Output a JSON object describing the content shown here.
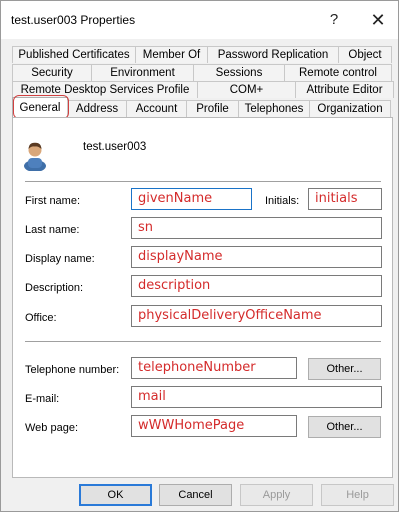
{
  "window": {
    "title": "test.user003 Properties",
    "help_glyph": "?",
    "close_glyph": "✕"
  },
  "tabs": {
    "row1": [
      "Published Certificates",
      "Member Of",
      "Password Replication",
      "Object"
    ],
    "row2": [
      "Security",
      "Environment",
      "Sessions",
      "Remote control"
    ],
    "row3": [
      "Remote Desktop Services Profile",
      "COM+",
      "Attribute Editor"
    ],
    "row4": [
      "General",
      "Address",
      "Account",
      "Profile",
      "Telephones",
      "Organization"
    ],
    "selected": "General"
  },
  "user": {
    "name": "test.user003"
  },
  "fields": {
    "first_name": {
      "label": "First name:",
      "value": "givenName"
    },
    "initials": {
      "label": "Initials:",
      "value": "initials"
    },
    "last_name": {
      "label": "Last name:",
      "value": "sn"
    },
    "display_name": {
      "label": "Display name:",
      "value": "displayName"
    },
    "description": {
      "label": "Description:",
      "value": "description"
    },
    "office": {
      "label": "Office:",
      "value": "physicalDeliveryOfficeName"
    },
    "telephone": {
      "label": "Telephone number:",
      "value": "telephoneNumber"
    },
    "email": {
      "label": "E-mail:",
      "value": "mail"
    },
    "web_page": {
      "label": "Web page:",
      "value": "wWWHomePage"
    }
  },
  "buttons": {
    "other_phone": "Other...",
    "other_web": "Other...",
    "ok": "OK",
    "cancel": "Cancel",
    "apply": "Apply",
    "help": "Help"
  },
  "colors": {
    "field_text": "#d42b2b",
    "highlight": "#d04040",
    "focus": "#1a73c8"
  }
}
